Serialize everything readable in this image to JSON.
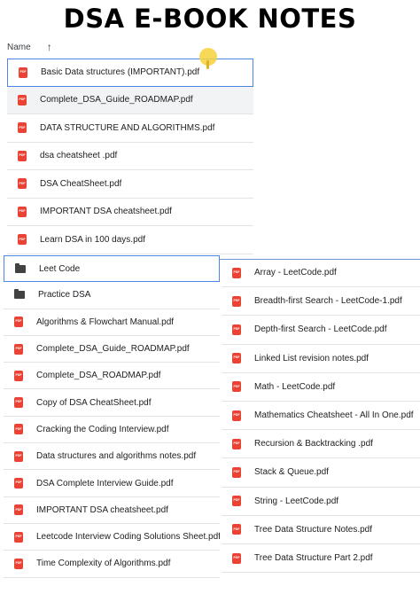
{
  "title": "DSA E-BOOK NOTES",
  "header": {
    "name_label": "Name",
    "sort_arrow": "↑"
  },
  "icons": {
    "pdf_text": "PDF"
  },
  "top_files": [
    {
      "label": "Basic Data structures (IMPORTANT).pdf",
      "type": "pdf"
    },
    {
      "label": "Complete_DSA_Guide_ROADMAP.pdf",
      "type": "pdf"
    },
    {
      "label": "DATA STRUCTURE AND ALGORITHMS.pdf",
      "type": "pdf"
    },
    {
      "label": "dsa cheatsheet .pdf",
      "type": "pdf"
    },
    {
      "label": "DSA CheatSheet.pdf",
      "type": "pdf"
    },
    {
      "label": "IMPORTANT DSA cheatsheet.pdf",
      "type": "pdf"
    },
    {
      "label": "Learn DSA in 100 days.pdf",
      "type": "pdf"
    }
  ],
  "left_items": [
    {
      "label": "Leet Code",
      "type": "folder"
    },
    {
      "label": "Practice DSA",
      "type": "folder"
    },
    {
      "label": "Algorithms & Flowchart Manual.pdf",
      "type": "pdf"
    },
    {
      "label": "Complete_DSA_Guide_ROADMAP.pdf",
      "type": "pdf"
    },
    {
      "label": "Complete_DSA_ROADMAP.pdf",
      "type": "pdf"
    },
    {
      "label": "Copy of DSA CheatSheet.pdf",
      "type": "pdf"
    },
    {
      "label": "Cracking the Coding Interview.pdf",
      "type": "pdf"
    },
    {
      "label": "Data structures and algorithms notes.pdf",
      "type": "pdf"
    },
    {
      "label": "DSA Complete Interview Guide.pdf",
      "type": "pdf"
    },
    {
      "label": "IMPORTANT DSA cheatsheet.pdf",
      "type": "pdf"
    },
    {
      "label": "Leetcode Interview Coding Solutions Sheet.pdf",
      "type": "pdf"
    },
    {
      "label": "Time Complexity of Algorithms.pdf",
      "type": "pdf"
    }
  ],
  "right_items": [
    {
      "label": "Array - LeetCode.pdf",
      "type": "pdf"
    },
    {
      "label": "Breadth-first Search - LeetCode-1.pdf",
      "type": "pdf"
    },
    {
      "label": "Depth-first Search - LeetCode.pdf",
      "type": "pdf"
    },
    {
      "label": "Linked List revision notes.pdf",
      "type": "pdf"
    },
    {
      "label": "Math - LeetCode.pdf",
      "type": "pdf"
    },
    {
      "label": "Mathematics Cheatsheet - All In One.pdf",
      "type": "pdf"
    },
    {
      "label": "Recursion & Backtracking .pdf",
      "type": "pdf"
    },
    {
      "label": "Stack & Queue.pdf",
      "type": "pdf"
    },
    {
      "label": "String - LeetCode.pdf",
      "type": "pdf"
    },
    {
      "label": "Tree Data Structure Notes.pdf",
      "type": "pdf"
    },
    {
      "label": "Tree Data Structure Part 2.pdf",
      "type": "pdf"
    }
  ],
  "colors": {
    "pdf_icon": "#ea4335",
    "folder_icon": "#424242",
    "selection_border": "#4b88e6"
  }
}
